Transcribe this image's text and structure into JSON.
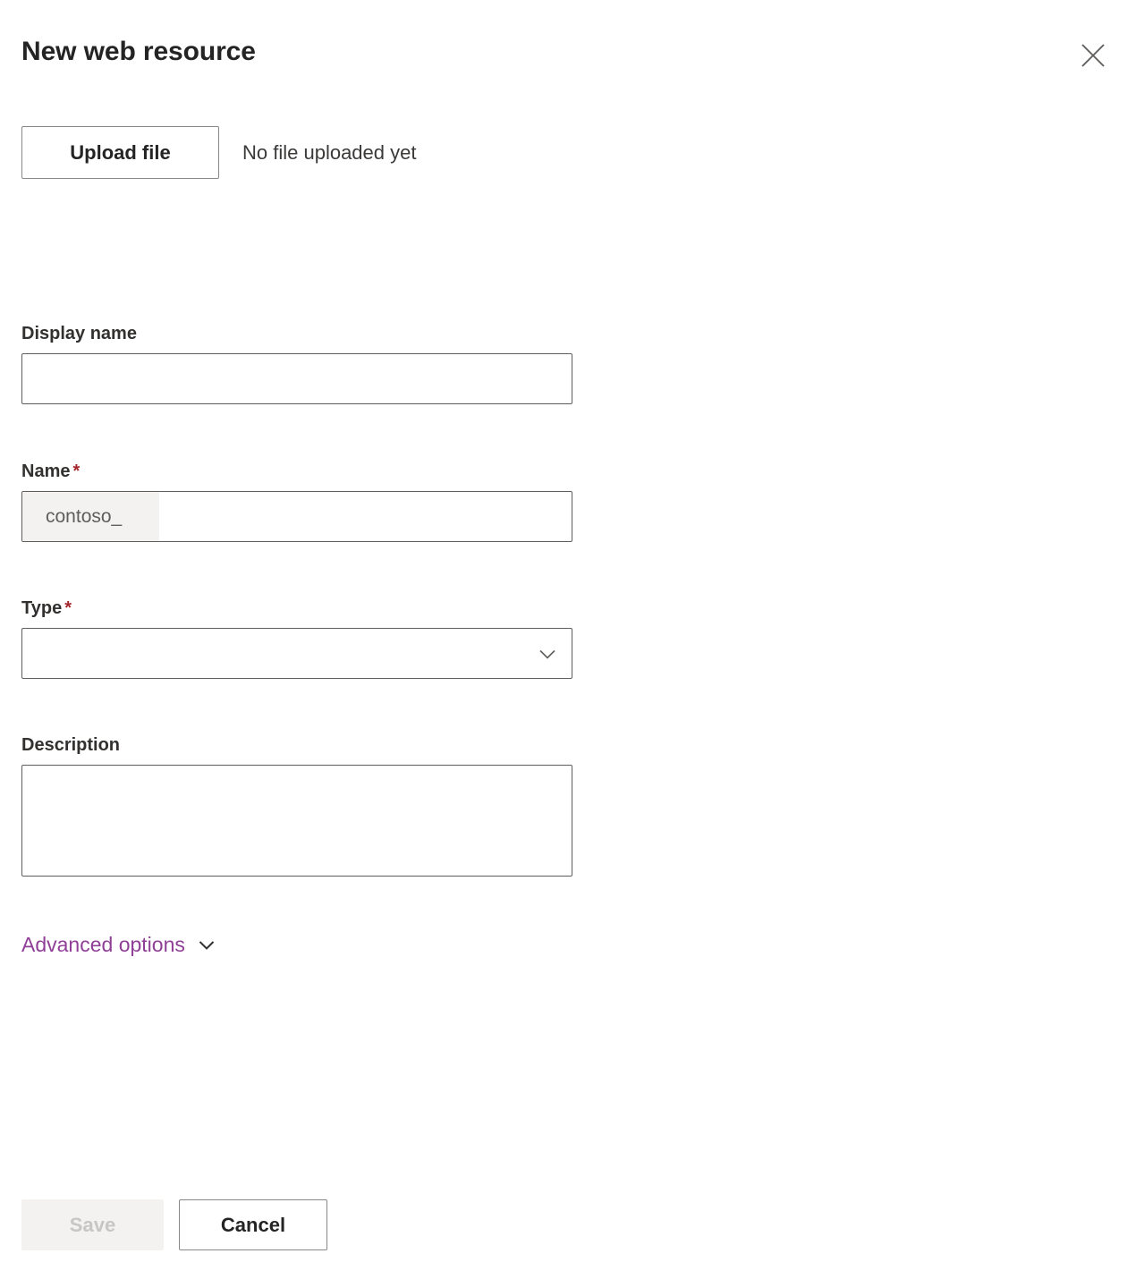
{
  "header": {
    "title": "New web resource",
    "close_icon": "close-icon"
  },
  "upload": {
    "button_label": "Upload file",
    "status_text": "No file uploaded yet"
  },
  "fields": {
    "display_name": {
      "label": "Display name",
      "value": "",
      "placeholder": ""
    },
    "name": {
      "label": "Name",
      "required_marker": "*",
      "prefix": "contoso_",
      "value": "",
      "placeholder": ""
    },
    "type": {
      "label": "Type",
      "required_marker": "*",
      "value": "",
      "chevron_icon": "chevron-down-icon"
    },
    "description": {
      "label": "Description",
      "value": "",
      "placeholder": ""
    }
  },
  "advanced": {
    "label": "Advanced options",
    "chevron_icon": "chevron-down-icon"
  },
  "footer": {
    "save_label": "Save",
    "cancel_label": "Cancel"
  },
  "colors": {
    "accent_purple": "#8f3f96",
    "required_red": "#a4262c",
    "border_gray": "#605e5c",
    "button_border": "#8a8886",
    "disabled_bg": "#f3f2f1",
    "disabled_text": "#c8c6c4",
    "text_primary": "#323130"
  }
}
